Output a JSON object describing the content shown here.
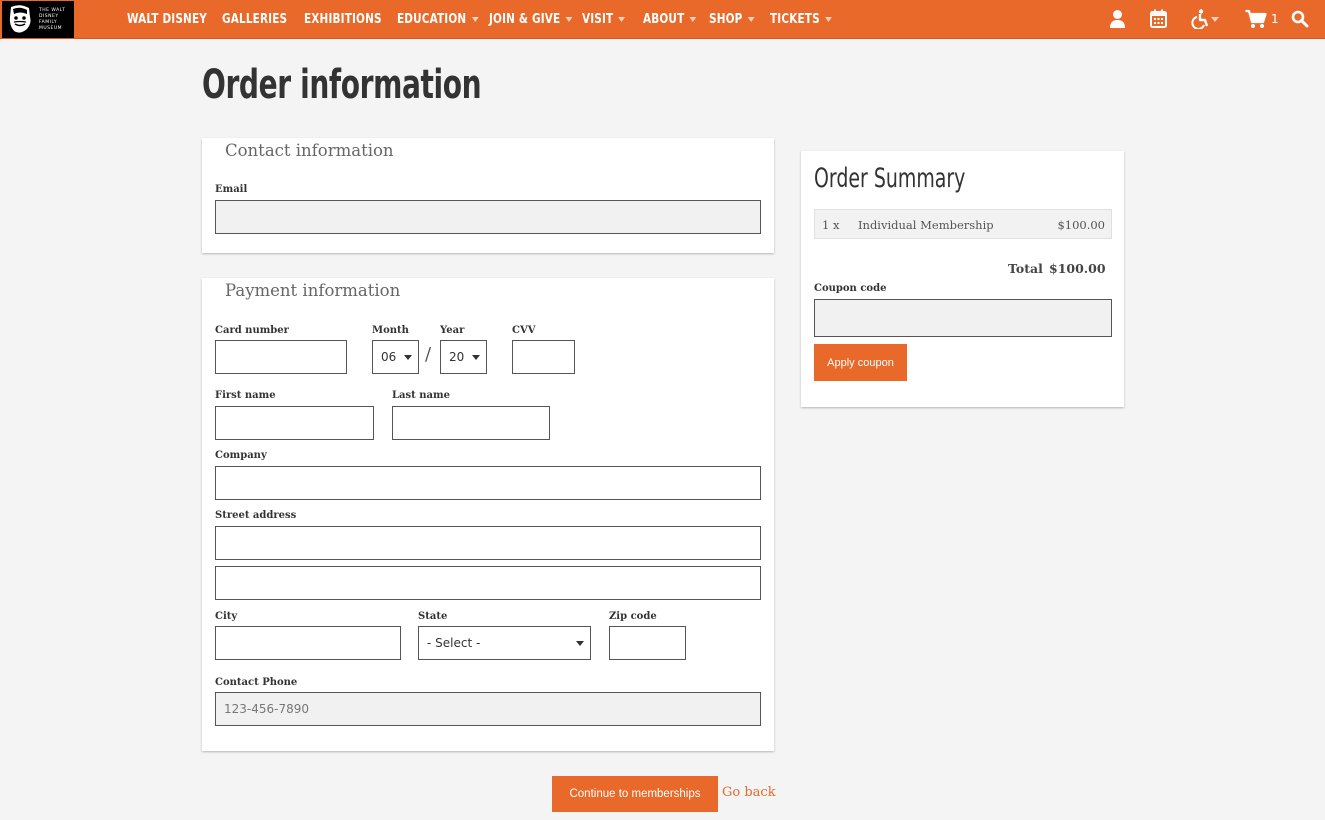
{
  "nav": {
    "logo_lines": [
      "THE WALT",
      "DISNEY",
      "FAMILY",
      "MUSEUM"
    ],
    "items": [
      {
        "label": "WALT DISNEY",
        "has_menu": false
      },
      {
        "label": "GALLERIES",
        "has_menu": false
      },
      {
        "label": "EXHIBITIONS",
        "has_menu": false
      },
      {
        "label": "EDUCATION",
        "has_menu": true
      },
      {
        "label": "JOIN & GIVE",
        "has_menu": true
      },
      {
        "label": "VISIT",
        "has_menu": true
      },
      {
        "label": "ABOUT",
        "has_menu": true
      },
      {
        "label": "SHOP",
        "has_menu": true
      },
      {
        "label": "TICKETS",
        "has_menu": true
      }
    ],
    "icons": [
      "user-icon",
      "calendar-icon",
      "accessibility-icon",
      "cart-icon",
      "search-icon"
    ],
    "cart_count": "1"
  },
  "page": {
    "title": "Order information"
  },
  "contact": {
    "heading": "Contact information",
    "email_label": "Email",
    "email_value": ""
  },
  "payment": {
    "heading": "Payment information",
    "card_number_label": "Card number",
    "month_label": "Month",
    "month_value": "06",
    "year_label": "Year",
    "year_value": "20",
    "cvv_label": "CVV",
    "first_name_label": "First name",
    "last_name_label": "Last name",
    "company_label": "Company",
    "street_label": "Street address",
    "city_label": "City",
    "state_label": "State",
    "state_value": "- Select -",
    "zip_label": "Zip code",
    "phone_label": "Contact Phone",
    "phone_placeholder": "123-456-7890"
  },
  "summary": {
    "title": "Order Summary",
    "item_qty": "1 x",
    "item_name": "Individual Membership",
    "item_price": "$100.00",
    "total_label": "Total",
    "total_value": "$100.00",
    "coupon_label": "Coupon code",
    "apply_label": "Apply coupon"
  },
  "actions": {
    "continue_label": "Continue to memberships",
    "back_label": "Go back"
  },
  "colors": {
    "accent": "#e8692a",
    "background": "#f4f4f4"
  }
}
